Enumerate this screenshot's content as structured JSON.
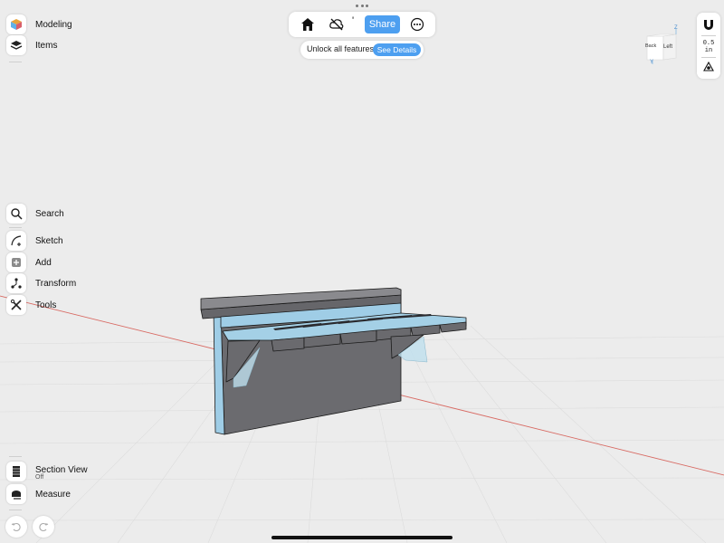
{
  "left_toolbar": {
    "modeling_label": "Modeling",
    "items_label": "Items",
    "search_label": "Search",
    "sketch_label": "Sketch",
    "add_label": "Add",
    "transform_label": "Transform",
    "tools_label": "Tools",
    "section_view_label": "Section View",
    "section_view_state": "Off",
    "measure_label": "Measure"
  },
  "top_bar": {
    "share_label": "Share",
    "apostrophe": "'",
    "unlock_text": "Unlock all features",
    "see_details_label": "See Details"
  },
  "view_cube": {
    "back_label": "Back",
    "left_label": "Left",
    "axis_z": "Z",
    "axis_y": "Y"
  },
  "units": {
    "grid_value": "0.5",
    "grid_unit": "in"
  },
  "icons": [
    "home-icon",
    "cloud-off-icon",
    "more-icon",
    "modeling-cube-icon",
    "layers-icon",
    "search-icon",
    "sketch-icon",
    "add-icon",
    "transform-icon",
    "tools-icon",
    "section-view-icon",
    "measure-icon",
    "undo-icon",
    "redo-icon",
    "magnet-icon",
    "snap-icon"
  ],
  "colors": {
    "accent": "#4d9ff0",
    "background": "#ececec",
    "model_body": "#6e6e72",
    "model_highlight": "#9fcde6",
    "axis_x": "#d86a63"
  }
}
